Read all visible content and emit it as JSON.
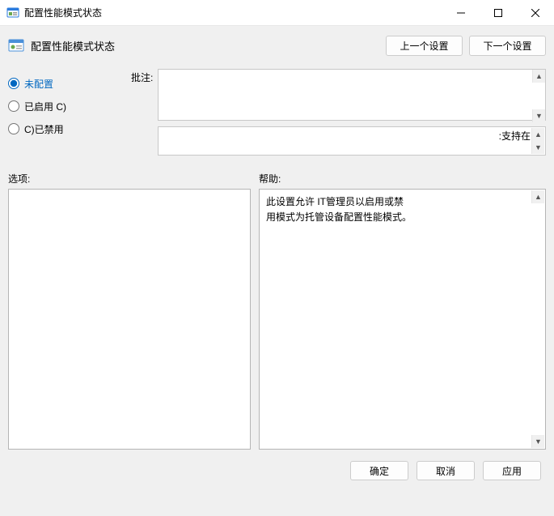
{
  "window": {
    "title": "配置性能模式状态"
  },
  "header": {
    "title": "配置性能模式状态",
    "prev_button": "上一个设置",
    "next_button": "下一个设置"
  },
  "radio": {
    "not_configured": "未配置",
    "enabled": "已启用 C)",
    "disabled": "C)已禁用",
    "selected": "not_configured"
  },
  "note": {
    "label": "批注:",
    "value": ""
  },
  "support": {
    "text": ":支持在"
  },
  "lower": {
    "options_label": "选项:",
    "help_label": "帮助:"
  },
  "help": {
    "line1": "此设置允许 IT管理员以启用或禁",
    "line2": "用模式为托管设备配置性能模式。"
  },
  "footer": {
    "ok": "确定",
    "cancel": "取消",
    "apply": "应用"
  }
}
